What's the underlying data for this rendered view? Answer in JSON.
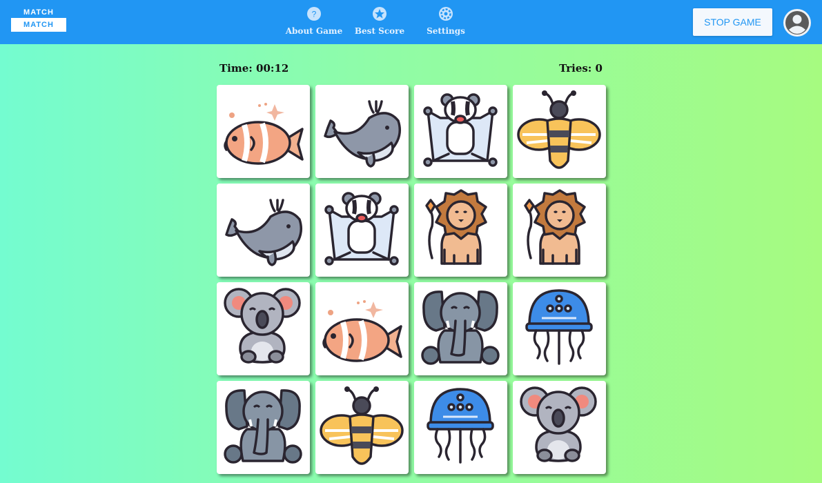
{
  "header": {
    "logo_top": "MATCH",
    "logo_bottom": "MATCH",
    "nav": [
      {
        "label": "About Game",
        "icon": "help-icon"
      },
      {
        "label": "Best Score",
        "icon": "star-icon"
      },
      {
        "label": "Settings",
        "icon": "gear-icon"
      }
    ],
    "stop_button": "STOP GAME",
    "avatar_icon": "user-avatar-icon"
  },
  "game": {
    "time": "Time: 00:12",
    "tries": "Tries: 0",
    "cards": [
      [
        "fish",
        "whale",
        "sugar-glider",
        "bee"
      ],
      [
        "whale",
        "sugar-glider",
        "lion",
        "lion"
      ],
      [
        "koala",
        "fish",
        "elephant",
        "jellyfish"
      ],
      [
        "elephant",
        "bee",
        "jellyfish",
        "koala"
      ]
    ]
  },
  "colors": {
    "header": "#2196f3",
    "background_left": "#74fcd0",
    "background_right": "#a6fb80"
  }
}
